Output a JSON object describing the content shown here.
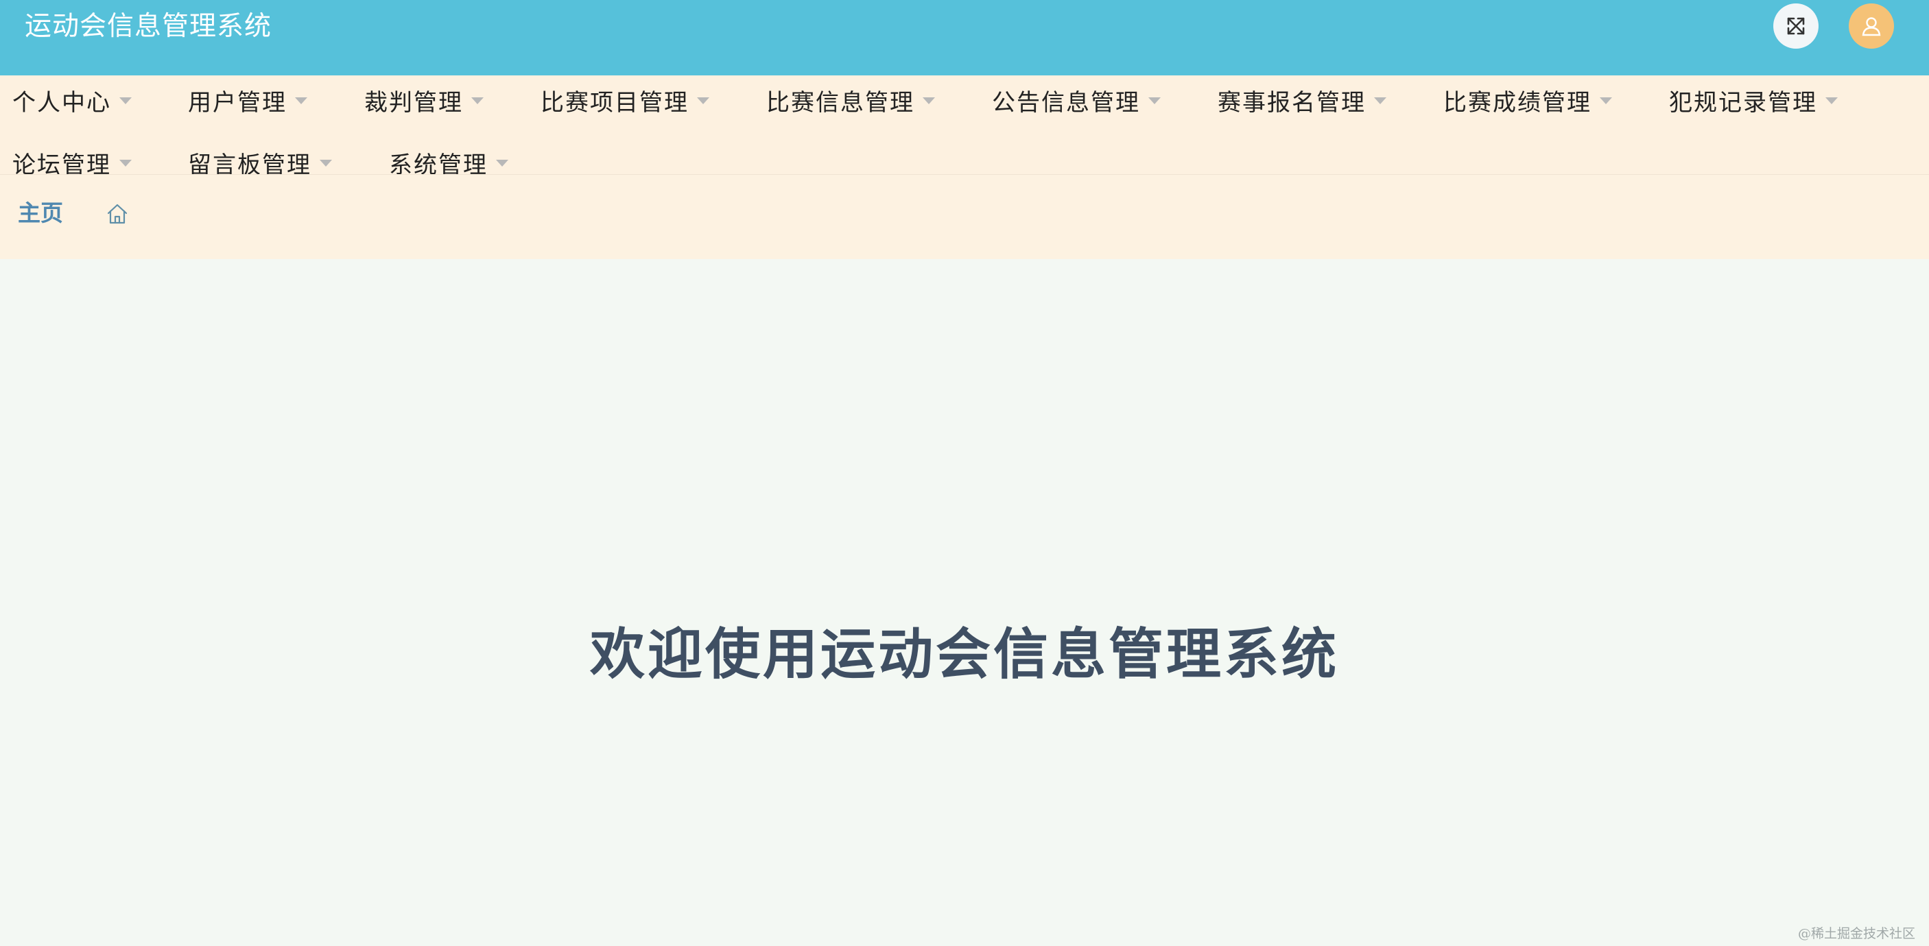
{
  "header": {
    "title": "运动会信息管理系统",
    "fullscreen_icon": "expand-arrows-icon",
    "user_icon": "user-avatar-icon",
    "accent_color": "#56c1da"
  },
  "nav": {
    "row1": [
      {
        "label": "个人中心"
      },
      {
        "label": "用户管理"
      },
      {
        "label": "裁判管理"
      },
      {
        "label": "比赛项目管理"
      },
      {
        "label": "比赛信息管理"
      },
      {
        "label": "公告信息管理"
      },
      {
        "label": "赛事报名管理"
      },
      {
        "label": "比赛成绩管理"
      },
      {
        "label": "犯规记录管理"
      }
    ],
    "row2": [
      {
        "label": "论坛管理"
      },
      {
        "label": "留言板管理"
      },
      {
        "label": "系统管理"
      }
    ]
  },
  "breadcrumb": {
    "home_label": "主页",
    "home_icon": "home-icon"
  },
  "main": {
    "welcome_text": "欢迎使用运动会信息管理系统"
  },
  "watermark": "@稀土掘金技术社区"
}
